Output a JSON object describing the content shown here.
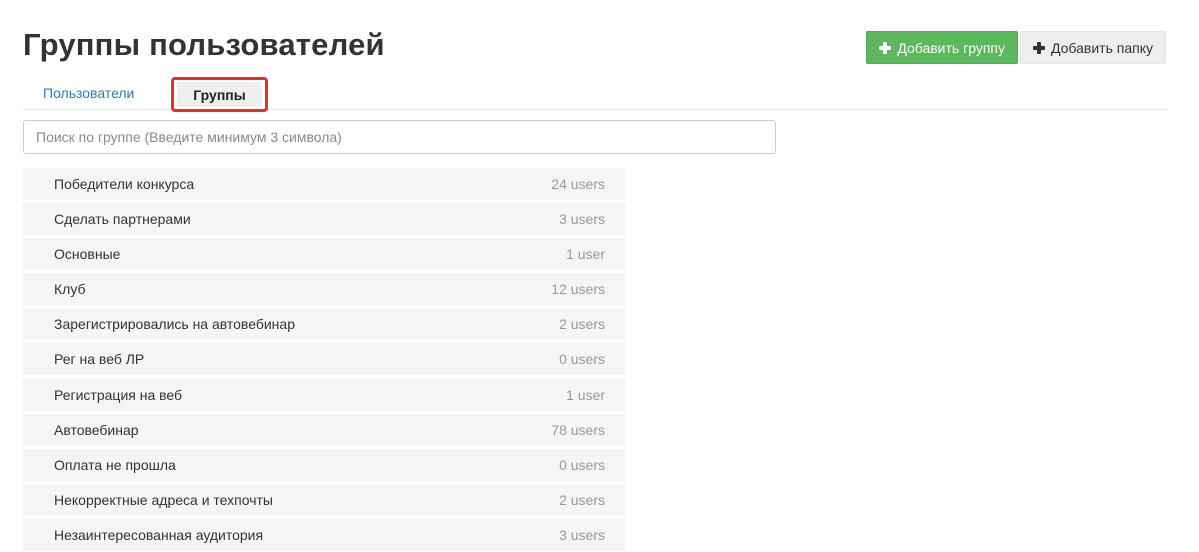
{
  "header": {
    "title": "Группы пользователей",
    "add_group_label": "Добавить группу",
    "add_folder_label": "Добавить папку"
  },
  "tabs": [
    {
      "label": "Пользователи",
      "active": false
    },
    {
      "label": "Группы",
      "active": true
    }
  ],
  "search": {
    "placeholder": "Поиск по группе (Введите минимум 3 символа)",
    "value": ""
  },
  "groups": [
    {
      "name": "Победители конкурса",
      "count": "24 users"
    },
    {
      "name": "Сделать партнерами",
      "count": "3 users"
    },
    {
      "name": "Основные",
      "count": "1 user"
    },
    {
      "name": "Клуб",
      "count": "12 users"
    },
    {
      "name": "Зарегистрировались на автовебинар",
      "count": "2 users"
    },
    {
      "name": "Рег на веб ЛР",
      "count": "0 users"
    },
    {
      "name": "Регистрация на веб",
      "count": "1 user"
    },
    {
      "name": "Автовебинар",
      "count": "78 users"
    },
    {
      "name": "Оплата не прошла",
      "count": "0 users"
    },
    {
      "name": "Некорректные адреса и техпочты",
      "count": "2 users"
    },
    {
      "name": "Незаинтересованная аудитория",
      "count": "3 users"
    }
  ],
  "colors": {
    "primary_button": "#5cb85c",
    "secondary_button": "#eeeeee",
    "link": "#337ab7",
    "highlight_border": "#e0322b",
    "row_background": "#f5f5f5"
  },
  "icons": {
    "add_group": "plus-icon",
    "add_folder": "plus-icon"
  }
}
